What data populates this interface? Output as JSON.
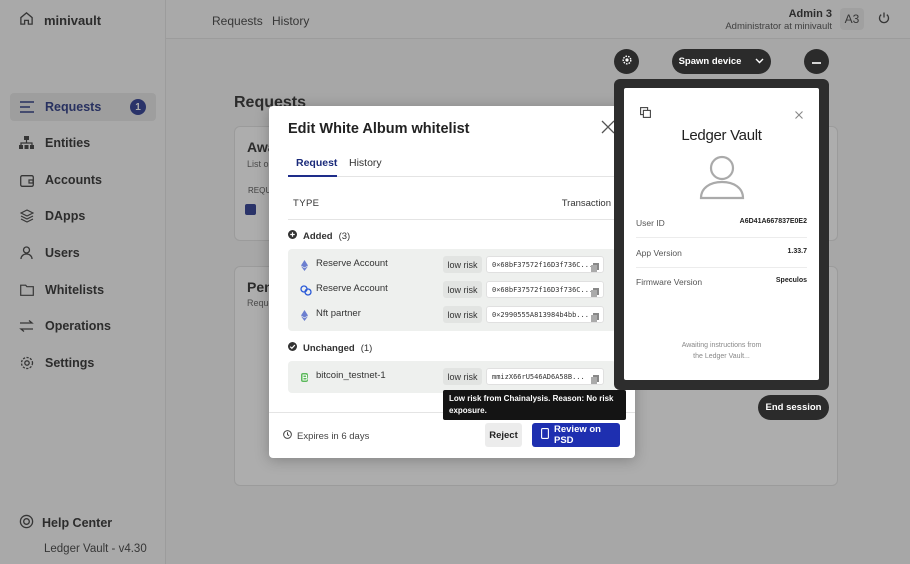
{
  "app": {
    "name": "minivault",
    "version": "Ledger Vault - v4.30"
  },
  "sidebar": {
    "items": [
      {
        "label": "Requests",
        "icon": "requests-icon",
        "badge": "1"
      },
      {
        "label": "Entities",
        "icon": "entities-icon"
      },
      {
        "label": "Accounts",
        "icon": "accounts-icon"
      },
      {
        "label": "DApps",
        "icon": "dapps-icon"
      },
      {
        "label": "Users",
        "icon": "users-icon"
      },
      {
        "label": "Whitelists",
        "icon": "whitelists-icon"
      },
      {
        "label": "Operations",
        "icon": "operations-icon"
      },
      {
        "label": "Settings",
        "icon": "settings-icon"
      }
    ],
    "help": "Help Center"
  },
  "topbar": {
    "tabs": [
      "Requests",
      "History"
    ],
    "user_name": "Admin 3",
    "user_role": "Administrator at minivault",
    "avatar": "A3"
  },
  "background": {
    "page_title": "Requests",
    "card1_title": "Awa",
    "card1_sub": "List o",
    "card1_col": "REQU",
    "card2_title": "Pen",
    "card2_sub": "Reque"
  },
  "modal": {
    "title": "Edit White Album whitelist",
    "tabs": [
      "Request",
      "History"
    ],
    "col_type": "TYPE",
    "col_tx": "Transaction",
    "added_label": "Added",
    "added_count": "(3)",
    "unchanged_label": "Unchanged",
    "unchanged_count": "(1)",
    "added_rows": [
      {
        "name": "Reserve Account",
        "risk": "low risk",
        "address": "0×68bF37572f16D3f736C..."
      },
      {
        "name": "Reserve Account",
        "risk": "low risk",
        "address": "0×68bF37572f16D3f736C..."
      },
      {
        "name": "Nft partner",
        "risk": "low risk",
        "address": "0×2990555A813984b4bb..."
      }
    ],
    "unchanged_rows": [
      {
        "name": "bitcoin_testnet-1",
        "risk": "low risk",
        "address": "mmizX66rU546AD6A58B..."
      }
    ],
    "expires": "Expires in 6 days",
    "reject": "Reject",
    "review": "Review on PSD"
  },
  "tooltip": "Low risk from Chainalysis. Reason: No risk exposure.",
  "device": {
    "spawn_label": "Spawn device",
    "title": "Ledger Vault",
    "fields": [
      {
        "key": "User ID",
        "value": "A6D41A667837E0E2"
      },
      {
        "key": "App Version",
        "value": "1.33.7"
      },
      {
        "key": "Firmware Version",
        "value": "Speculos"
      }
    ],
    "message_line1": "Awaiting instructions from",
    "message_line2": "the Ledger Vault...",
    "end_session": "End session"
  },
  "colors": {
    "accent": "#1e2d8a",
    "primary_button": "#1e2fb0",
    "device_bg": "#2d2d2d"
  }
}
